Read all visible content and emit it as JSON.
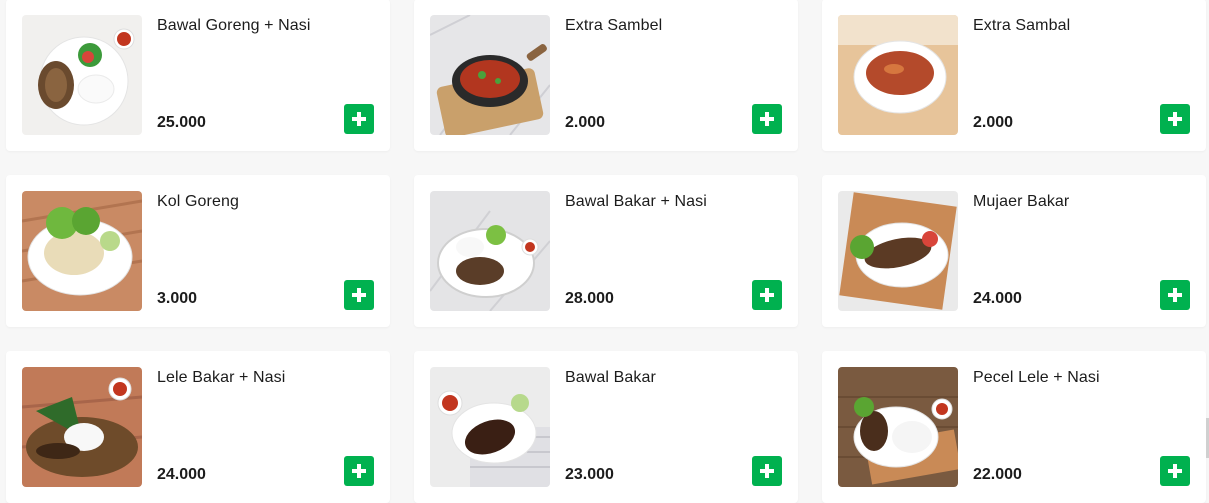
{
  "colors": {
    "accent": "#00b14f",
    "card_bg": "#ffffff",
    "page_bg": "#f7f7f7"
  },
  "menu": {
    "items": [
      {
        "name": "Bawal Goreng + Nasi",
        "price": "25.000",
        "image": "fried-pomfret-rice-plate"
      },
      {
        "name": "Extra Sambel",
        "price": "2.000",
        "image": "sambal-in-cast-iron-pan"
      },
      {
        "name": "Extra Sambal",
        "price": "2.000",
        "image": "sambal-bowl"
      },
      {
        "name": "Kol Goreng",
        "price": "3.000",
        "image": "fried-cabbage-plate"
      },
      {
        "name": "Bawal Bakar + Nasi",
        "price": "28.000",
        "image": "grilled-pomfret-rice-plate"
      },
      {
        "name": "Mujaer Bakar",
        "price": "24.000",
        "image": "grilled-tilapia-plate"
      },
      {
        "name": "Lele Bakar + Nasi",
        "price": "24.000",
        "image": "grilled-catfish-rice-basket"
      },
      {
        "name": "Bawal Bakar",
        "price": "23.000",
        "image": "grilled-pomfret-plate"
      },
      {
        "name": "Pecel Lele + Nasi",
        "price": "22.000",
        "image": "pecel-lele-rice-plate"
      }
    ],
    "add_icon": "plus-icon"
  }
}
